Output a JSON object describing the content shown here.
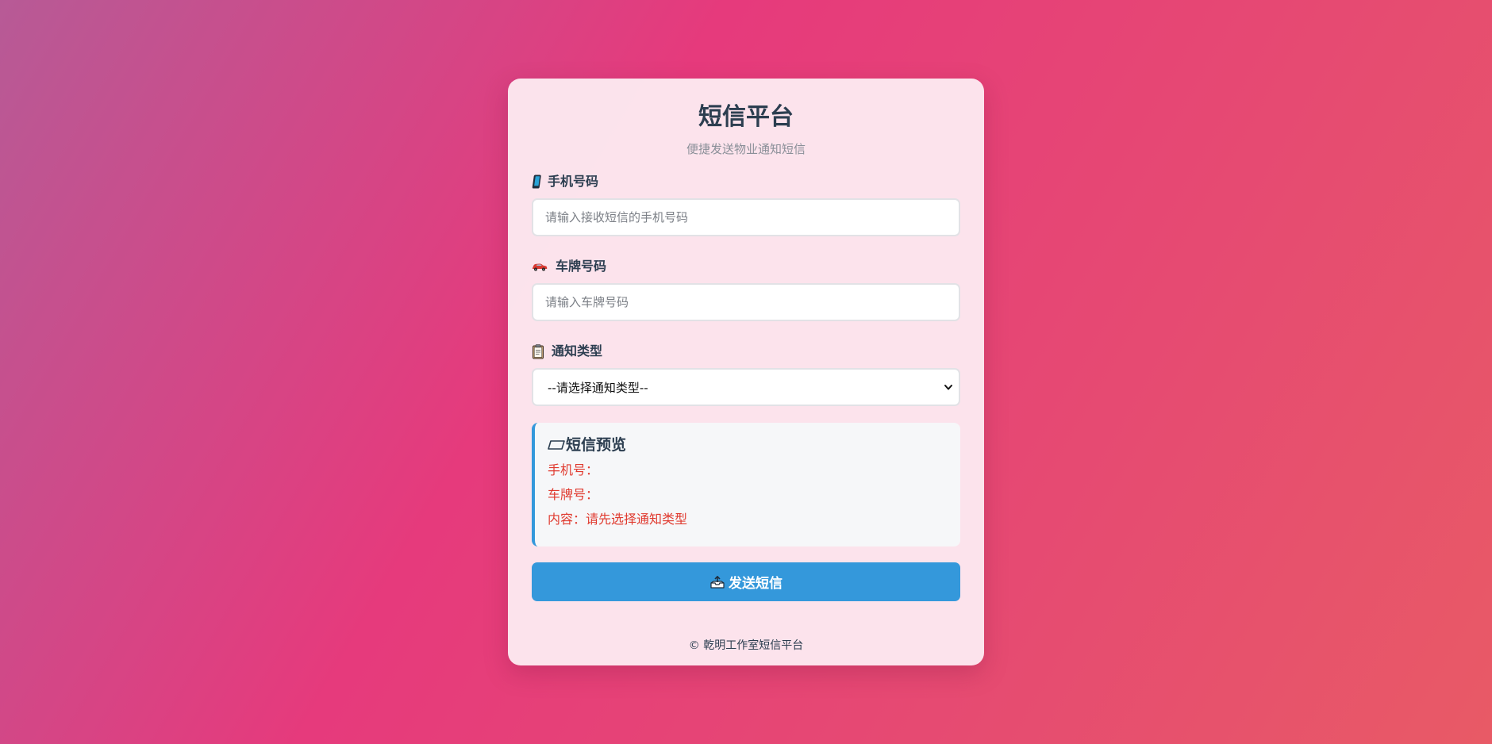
{
  "header": {
    "title": "短信平台",
    "subtitle": "便捷发送物业通知短信"
  },
  "form": {
    "phone": {
      "icon": "mobile-phone-icon",
      "label": "手机号码",
      "placeholder": "请输入接收短信的手机号码",
      "value": ""
    },
    "plate": {
      "icon": "car-icon",
      "label": "车牌号码",
      "placeholder": "请输入车牌号码",
      "value": ""
    },
    "notice_type": {
      "icon": "clipboard-icon",
      "label": "通知类型",
      "selected": "--请选择通知类型--"
    }
  },
  "preview": {
    "icon": "sms-card-icon",
    "title": "短信预览",
    "phone_row": "手机号：",
    "plate_row": "车牌号：",
    "content_row": "内容：请先选择通知类型"
  },
  "send_button": {
    "icon": "outbox-tray-icon",
    "label": "发送短信"
  },
  "footer": {
    "text": "© 乾明工作室短信平台"
  },
  "colors": {
    "accent": "#3498db",
    "preview_text": "#e03a2f",
    "heading": "#2c3e50",
    "background_start": "#b75a96",
    "background_end": "#e85a66"
  }
}
